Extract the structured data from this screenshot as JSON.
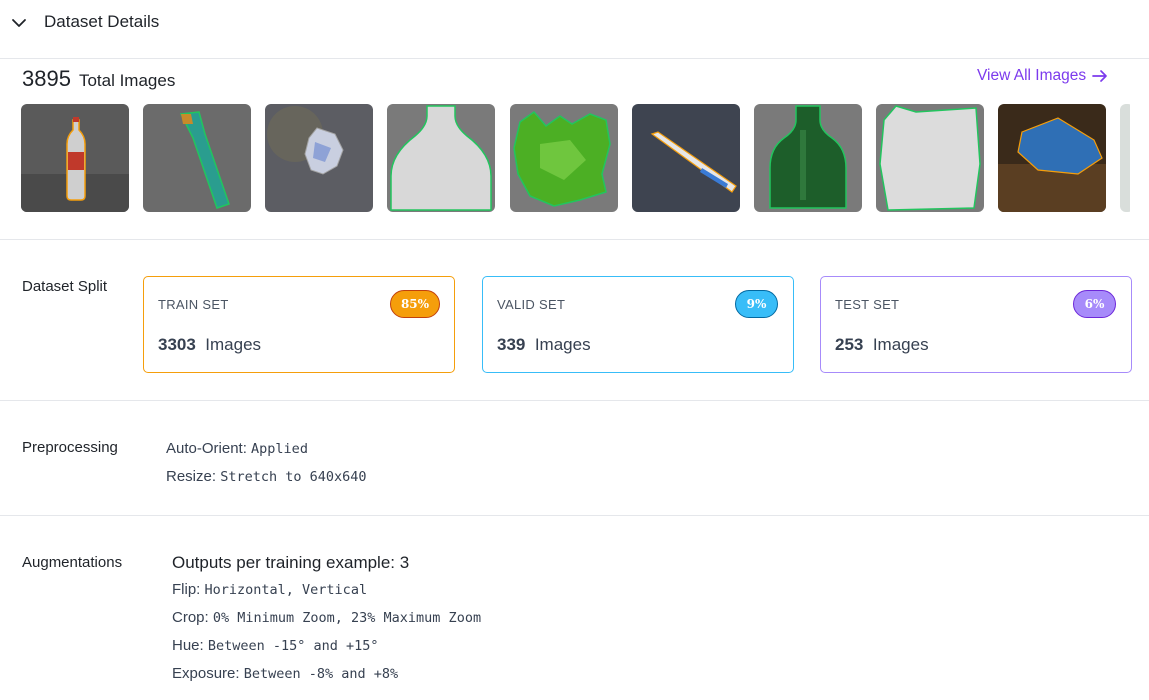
{
  "header": {
    "title": "Dataset Details",
    "toggle_icon": "chevron-down-icon"
  },
  "summary": {
    "count": "3895",
    "label": "Total Images",
    "view_all": "View All Images",
    "view_all_icon": "arrow-right-icon",
    "link_color": "#7c3aed"
  },
  "thumbnails": [
    {
      "subject": "plastic bottle",
      "outline": "#f59e0b"
    },
    {
      "subject": "plastic strip",
      "outline": "#22c55e"
    },
    {
      "subject": "crumpled plastic",
      "outline": "#a3a3a3"
    },
    {
      "subject": "white bottle",
      "outline": "#22c55e"
    },
    {
      "subject": "green plastic bag",
      "outline": "#22c55e"
    },
    {
      "subject": "toothbrush",
      "outline": "#f59e0b"
    },
    {
      "subject": "green glass bottle",
      "outline": "#22c55e"
    },
    {
      "subject": "white pouch",
      "outline": "#22c55e"
    },
    {
      "subject": "blue plastic",
      "outline": "#f59e0b"
    }
  ],
  "split": {
    "label": "Dataset Split",
    "sets": [
      {
        "name": "TRAIN SET",
        "count": "3303",
        "unit": "Images",
        "percent": "85%",
        "color": "#f59e0b"
      },
      {
        "name": "VALID SET",
        "count": "339",
        "unit": "Images",
        "percent": "9%",
        "color": "#38bdf8"
      },
      {
        "name": "TEST SET",
        "count": "253",
        "unit": "Images",
        "percent": "6%",
        "color": "#a78bfa"
      }
    ]
  },
  "preprocessing": {
    "label": "Preprocessing",
    "items": [
      {
        "key": "Auto-Orient:",
        "value": "Applied"
      },
      {
        "key": "Resize:",
        "value": "Stretch to 640x640"
      }
    ]
  },
  "augmentations": {
    "label": "Augmentations",
    "outputs": "Outputs per training example: 3",
    "items": [
      {
        "key": "Flip:",
        "value": "Horizontal, Vertical"
      },
      {
        "key": "Crop:",
        "value": "0% Minimum Zoom, 23% Maximum Zoom"
      },
      {
        "key": "Hue:",
        "value": "Between -15° and +15°"
      },
      {
        "key": "Exposure:",
        "value": "Between -8% and +8%"
      }
    ]
  }
}
